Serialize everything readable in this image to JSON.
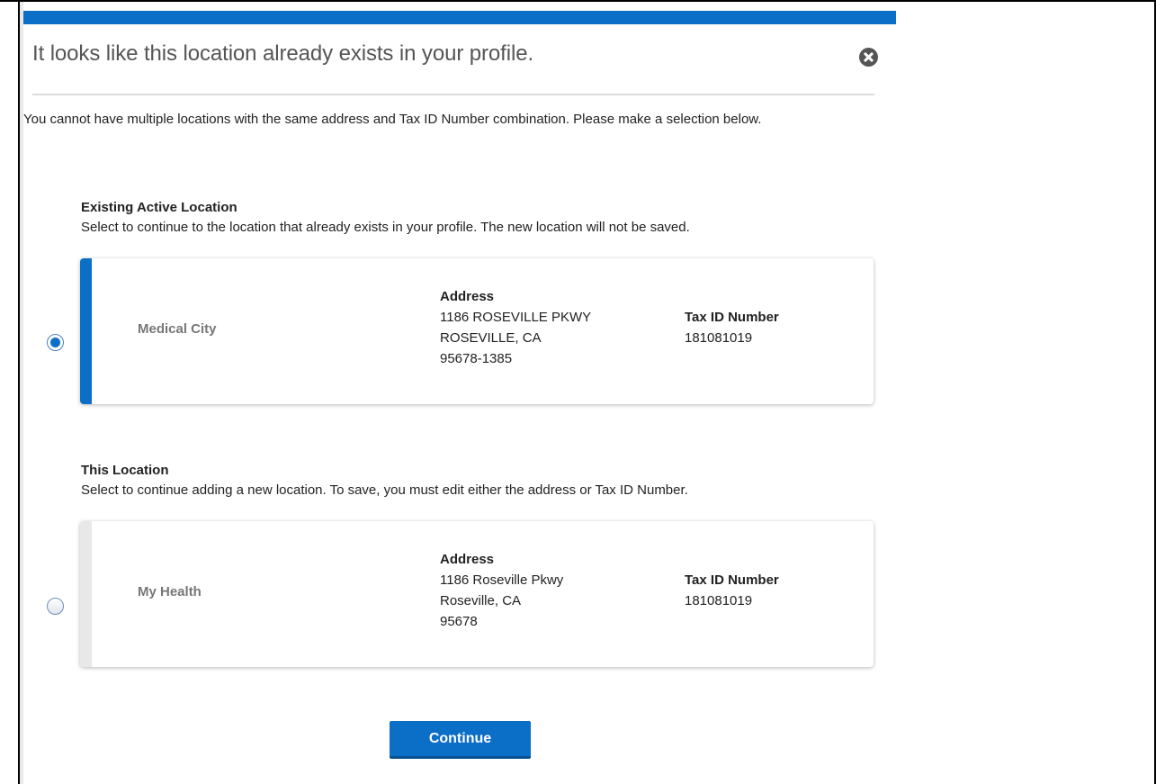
{
  "modal": {
    "title": "It looks like this location already exists in your profile.",
    "intro": "You cannot have multiple locations with the same address and Tax ID Number combination. Please make a selection below.",
    "close_icon": "close-circle-icon",
    "accent_color": "#0b6ec7"
  },
  "existing": {
    "heading": "Existing Active Location",
    "description": "Select to continue to the location that already exists in your profile. The new location will not be saved.",
    "selected": true,
    "name": "Medical City",
    "address_label": "Address",
    "address_line1": "1186 ROSEVILLE PKWY",
    "address_line2": "ROSEVILLE, CA",
    "address_line3": "95678-1385",
    "tax_label": "Tax ID Number",
    "tax_id": "181081019"
  },
  "this_location": {
    "heading": "This Location",
    "description": "Select to continue adding a new location. To save, you must edit either the address or Tax ID Number.",
    "selected": false,
    "name": "My Health",
    "address_label": "Address",
    "address_line1": "1186 Roseville Pkwy",
    "address_line2": "Roseville, CA",
    "address_line3": "95678",
    "tax_label": "Tax ID Number",
    "tax_id": "181081019"
  },
  "actions": {
    "continue_label": "Continue"
  }
}
